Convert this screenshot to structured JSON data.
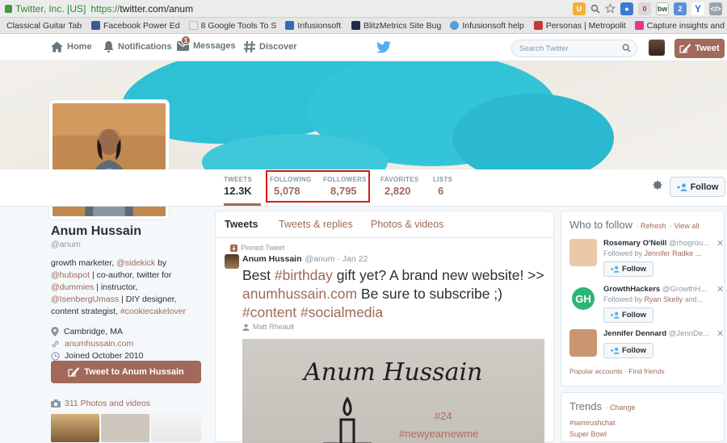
{
  "browser": {
    "secure_label": "Twitter, Inc. [US]",
    "url_scheme": "https://",
    "url_rest": "twitter.com/anum",
    "ext_badge": "bw"
  },
  "bookmarks": [
    {
      "label": "Classical Guitar Tab",
      "color": "#ffffff"
    },
    {
      "label": "Facebook Power Ed",
      "color": "#3b5998"
    },
    {
      "label": "8 Google Tools To S",
      "color": "#e9e9e9"
    },
    {
      "label": "Infusionsoft",
      "color": "#2b6fb3"
    },
    {
      "label": "BlitzMetrics Site Bug",
      "color": "#222a45"
    },
    {
      "label": "Infusionsoft help",
      "color": "#4fa3d9"
    },
    {
      "label": "Personas | Metropolit",
      "color": "#c03c3c"
    },
    {
      "label": "Capture insights and",
      "color": "#e33a8c"
    }
  ],
  "nav": {
    "home": "Home",
    "notifications": "Notifications",
    "messages": "Messages",
    "messages_badge": "1",
    "discover": "Discover",
    "search_placeholder": "Search Twitter",
    "tweet_button": "Tweet"
  },
  "stats": [
    {
      "label": "TWEETS",
      "value": "12.3K",
      "active": true
    },
    {
      "label": "FOLLOWING",
      "value": "5,078"
    },
    {
      "label": "FOLLOWERS",
      "value": "8,795"
    },
    {
      "label": "FAVORITES",
      "value": "2,820"
    },
    {
      "label": "LISTS",
      "value": "6"
    }
  ],
  "follow_button": "Follow",
  "profile": {
    "name": "Anum Hussain",
    "handle": "@anum",
    "bio_1": "growth marketer,",
    "bio_sidekick": "@sidekick",
    "bio_by": "by",
    "bio_hubspot": "@hubspot",
    "bio_2": "| co-author, twitter for",
    "bio_dummies": "@dummies",
    "bio_3": "| instructor,",
    "bio_umass": "@IsenbergUmass",
    "bio_4": "| DIY designer, content strategist,",
    "bio_cookie": "#cookiecakelover",
    "location": "Cambridge, MA",
    "website": "anumhussain.com",
    "joined": "Joined October 2010",
    "tweet_to": "Tweet to Anum Hussain",
    "photos": "311 Photos and videos"
  },
  "timeline": {
    "tabs": [
      "Tweets",
      "Tweets & replies",
      "Photos & videos"
    ],
    "pinned_label": "Pinned Tweet",
    "author": "Anum Hussain",
    "author_meta": "@anum · Jan 22",
    "text_1": "Best",
    "text_birthday": "#birthday",
    "text_2": "gift yet? A brand new website! >>",
    "text_link": "anumhussain.com",
    "text_3": "Be sure to subscribe ;)",
    "text_content": "#content",
    "text_social": "#socialmedia",
    "retweeted_by": "Matt Rheault",
    "image_title": "Anum Hussain",
    "image_number": "#24",
    "image_tag": "#newyearnewme"
  },
  "who_to_follow": {
    "title": "Who to follow",
    "refresh": "Refresh",
    "view_all": "View all",
    "button": "Follow",
    "suggestions": [
      {
        "name": "Rosemary O'Neill",
        "handle": "@rhogrou...",
        "by_label": "Followed by",
        "by": "Jennifer Radke ...",
        "avatar": "#e9c9a8"
      },
      {
        "name": "GrowthHackers",
        "handle": "@GrowthH...",
        "by_label": "Followed by",
        "by": "Ryan Skelly",
        "by_after": "and...",
        "avatar": "#2bb673"
      },
      {
        "name": "Jennifer Dennard",
        "handle": "@JennDe...",
        "by_label": "",
        "by": "",
        "avatar": "#c99670"
      }
    ],
    "footer_popular": "Popular accounts",
    "footer_find": "Find friends"
  },
  "trends": {
    "title": "Trends",
    "change": "Change",
    "items": [
      "#semrushchat",
      "Super Bowl"
    ]
  },
  "colors": {
    "accent": "#a0695a",
    "highlight_box": "#d21c1c",
    "twitter_blue": "#55acee"
  }
}
